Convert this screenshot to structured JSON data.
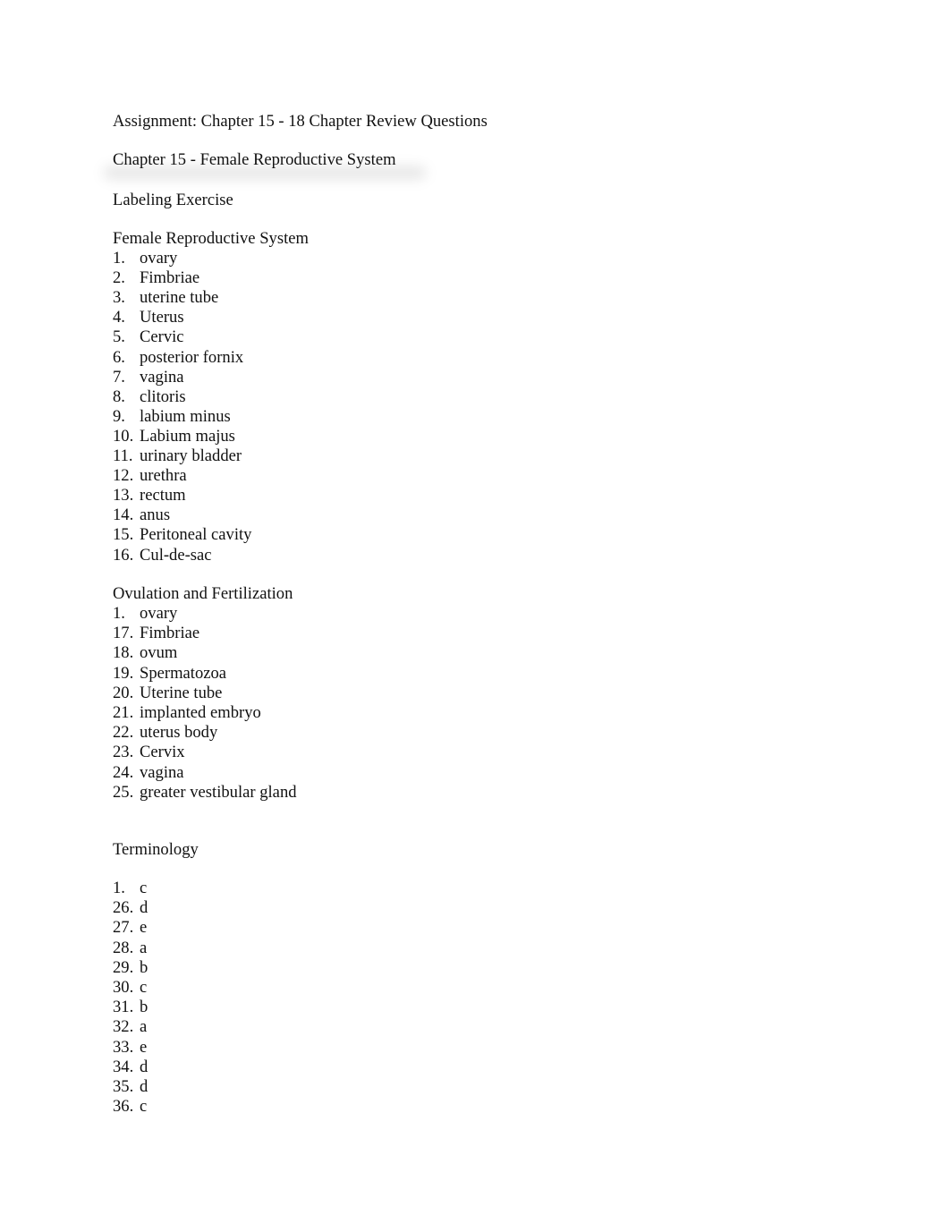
{
  "document": {
    "assignment_title": "Assignment:  Chapter 15 - 18 Chapter Review Questions",
    "chapter_title": "Chapter 15 - Female Reproductive System",
    "exercise_title": "Labeling Exercise",
    "sections": [
      {
        "heading": "Female Reproductive System",
        "items": [
          {
            "num": "1.",
            "text": "ovary"
          },
          {
            "num": "2.",
            "text": "Fimbriae"
          },
          {
            "num": "3.",
            "text": "uterine tube"
          },
          {
            "num": "4.",
            "text": "Uterus"
          },
          {
            "num": "5.",
            "text": "Cervic"
          },
          {
            "num": "6.",
            "text": "posterior fornix"
          },
          {
            "num": "7.",
            "text": "vagina"
          },
          {
            "num": "8.",
            "text": "clitoris"
          },
          {
            "num": "9.",
            "text": "labium minus"
          },
          {
            "num": "10.",
            "text": "Labium majus"
          },
          {
            "num": "11.",
            "text": "urinary bladder"
          },
          {
            "num": "12.",
            "text": "urethra"
          },
          {
            "num": "13.",
            "text": "rectum"
          },
          {
            "num": "14.",
            "text": "anus"
          },
          {
            "num": "15.",
            "text": "Peritoneal cavity"
          },
          {
            "num": "16.",
            "text": "Cul-de-sac"
          }
        ]
      },
      {
        "heading": "Ovulation and Fertilization",
        "items": [
          {
            "num": "1.",
            "text": "ovary"
          },
          {
            "num": "17.",
            "text": "Fimbriae"
          },
          {
            "num": "18.",
            "text": "ovum"
          },
          {
            "num": "19.",
            "text": "Spermatozoa"
          },
          {
            "num": "20.",
            "text": "Uterine tube"
          },
          {
            "num": "21.",
            "text": "implanted embryo"
          },
          {
            "num": "22.",
            "text": "uterus body"
          },
          {
            "num": "23.",
            "text": "Cervix"
          },
          {
            "num": "24.",
            "text": "vagina"
          },
          {
            "num": "25.",
            "text": "greater vestibular gland"
          }
        ]
      },
      {
        "heading": "Terminology",
        "items": [
          {
            "num": "1.",
            "text": "c"
          },
          {
            "num": "26.",
            "text": "d"
          },
          {
            "num": "27.",
            "text": "e"
          },
          {
            "num": "28.",
            "text": "a"
          },
          {
            "num": "29.",
            "text": "b"
          },
          {
            "num": "30.",
            "text": "c"
          },
          {
            "num": "31.",
            "text": "b"
          },
          {
            "num": "32.",
            "text": "a"
          },
          {
            "num": "33.",
            "text": "e"
          },
          {
            "num": "34.",
            "text": "d"
          },
          {
            "num": "35.",
            "text": "d"
          },
          {
            "num": "36.",
            "text": "c"
          }
        ]
      }
    ]
  }
}
